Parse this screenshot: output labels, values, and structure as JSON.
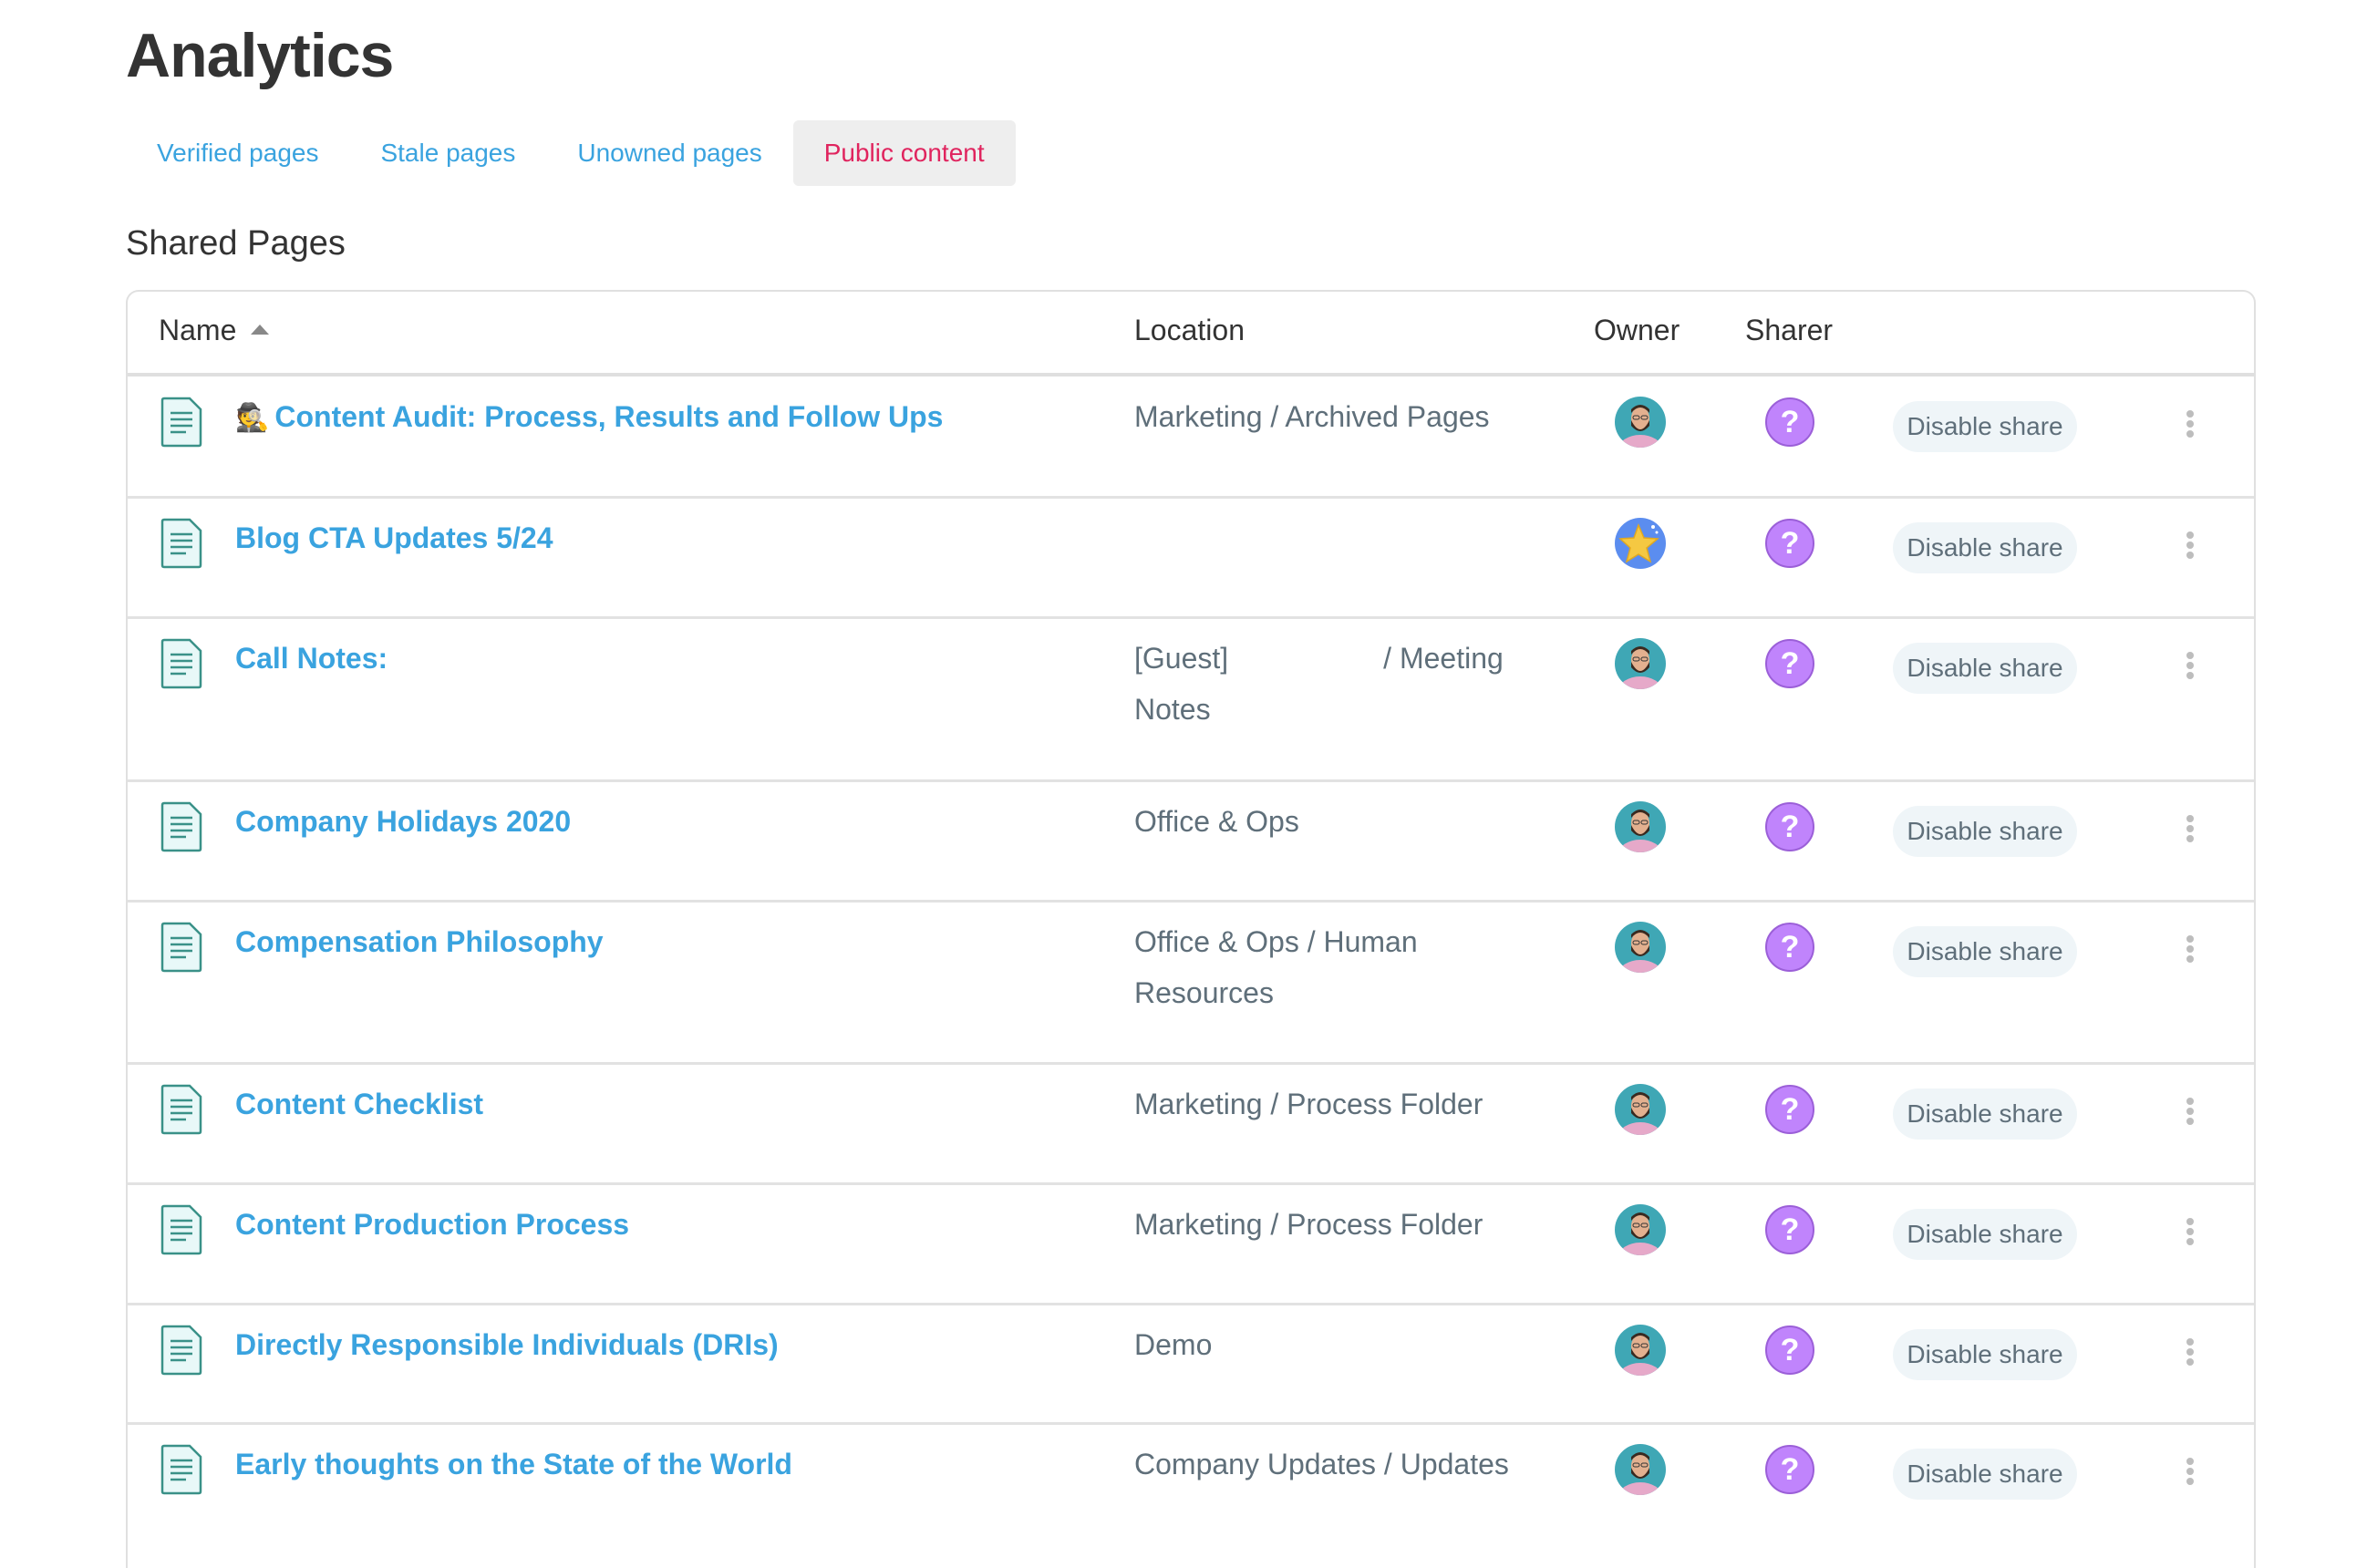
{
  "page": {
    "title": "Analytics"
  },
  "tabs": [
    {
      "label": "Verified pages",
      "active": false
    },
    {
      "label": "Stale pages",
      "active": false
    },
    {
      "label": "Unowned pages",
      "active": false
    },
    {
      "label": "Public content",
      "active": true
    }
  ],
  "section": {
    "title": "Shared Pages"
  },
  "table": {
    "columns": {
      "name": "Name",
      "location": "Location",
      "owner": "Owner",
      "sharer": "Sharer"
    },
    "sort": {
      "column": "Name",
      "direction": "ascending"
    },
    "action_label": "Disable share",
    "rows": [
      {
        "emoji": "🕵️",
        "name": "Content Audit: Process, Results and Follow Ups",
        "location": "Marketing / Archived Pages",
        "owner_avatar": "person-photo",
        "sharer_icon": "unknown-user-question-icon"
      },
      {
        "emoji": "",
        "name": "Blog CTA Updates 5/24",
        "location": "",
        "owner_avatar": "starfish-avatar",
        "sharer_icon": "unknown-user-question-icon"
      },
      {
        "emoji": "",
        "name": "Call Notes:",
        "location_parts": [
          "[Guest]",
          "/ Meeting Notes"
        ],
        "location": "[Guest]  / Meeting Notes",
        "owner_avatar": "person-photo",
        "sharer_icon": "unknown-user-question-icon"
      },
      {
        "emoji": "",
        "name": "Company Holidays 2020",
        "location": "Office & Ops",
        "owner_avatar": "person-photo",
        "sharer_icon": "unknown-user-question-icon"
      },
      {
        "emoji": "",
        "name": "Compensation Philosophy",
        "location": "Office & Ops / Human Resources",
        "owner_avatar": "person-photo",
        "sharer_icon": "unknown-user-question-icon"
      },
      {
        "emoji": "",
        "name": "Content Checklist",
        "location": "Marketing / Process Folder",
        "owner_avatar": "person-photo",
        "sharer_icon": "unknown-user-question-icon"
      },
      {
        "emoji": "",
        "name": "Content Production Process",
        "location": "Marketing / Process Folder",
        "owner_avatar": "person-photo",
        "sharer_icon": "unknown-user-question-icon"
      },
      {
        "emoji": "",
        "name": "Directly Responsible Individuals (DRIs)",
        "location": "Demo",
        "owner_avatar": "person-photo",
        "sharer_icon": "unknown-user-question-icon"
      },
      {
        "emoji": "",
        "name": "Early thoughts on the State of the World",
        "location": "Company Updates / Updates",
        "owner_avatar": "person-photo",
        "sharer_icon": "unknown-user-question-icon"
      }
    ]
  },
  "colors": {
    "link": "#3aa3df",
    "active_tab": "#e0245e",
    "active_tab_bg": "#eeeeee",
    "location_text": "#5f6f7a",
    "sharer_unknown": "#c084fc",
    "doc_icon": "#3a9188"
  }
}
